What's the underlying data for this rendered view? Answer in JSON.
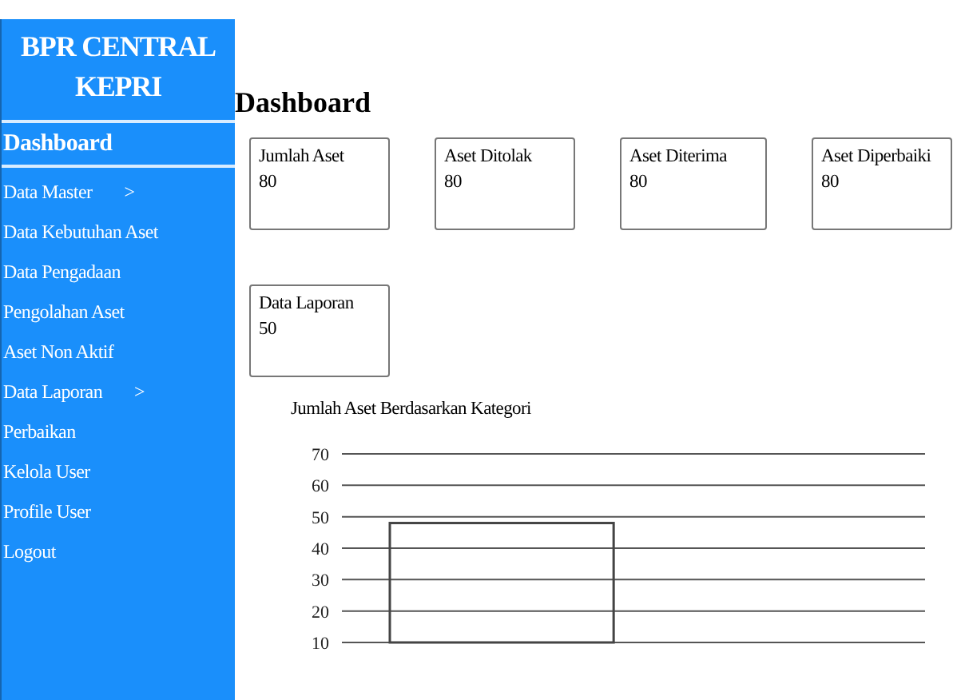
{
  "brand": "BPR CENTRAL KEPRI",
  "nav": [
    {
      "label": "Dashboard",
      "selected": true
    },
    {
      "label": "Data Master",
      "arrow": ">",
      "selected": false
    },
    {
      "label": "Data Kebutuhan Aset",
      "selected": false
    },
    {
      "label": "Data Pengadaan",
      "selected": false
    },
    {
      "label": "Pengolahan Aset",
      "selected": false
    },
    {
      "label": "Aset Non Aktif",
      "selected": false
    },
    {
      "label": "Data Laporan",
      "arrow": ">",
      "selected": false
    },
    {
      "label": "Perbaikan",
      "selected": false
    },
    {
      "label": "Kelola User",
      "selected": false
    },
    {
      "label": "Profile User",
      "selected": false
    },
    {
      "label": "Logout",
      "selected": false
    }
  ],
  "page_title": "Dashboard",
  "cards": [
    {
      "label": "Jumlah Aset",
      "value": "80"
    },
    {
      "label": "Aset Ditolak",
      "value": "80"
    },
    {
      "label": "Aset Diterima",
      "value": "80"
    },
    {
      "label": "Aset Diperbaiki",
      "value": "80"
    },
    {
      "label": "Data Laporan",
      "value": "50"
    }
  ],
  "chart": {
    "title": "Jumlah Aset Berdasarkan Kategori",
    "chart_data": {
      "type": "bar",
      "values": [
        48
      ],
      "ylim": [
        10,
        70
      ],
      "yticks": [
        10,
        20,
        30,
        40,
        50,
        60,
        70
      ],
      "grid": true
    }
  }
}
